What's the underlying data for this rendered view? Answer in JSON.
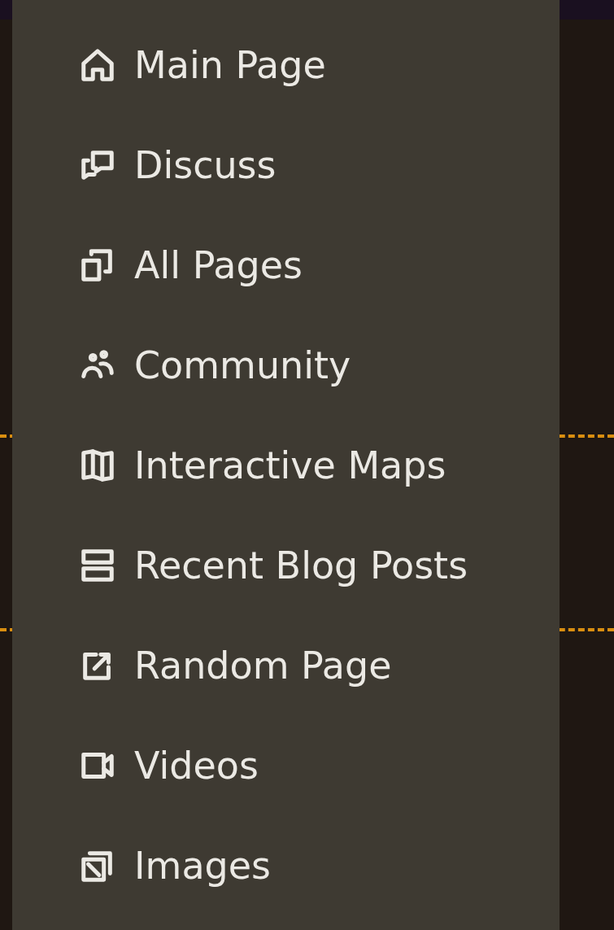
{
  "menu": {
    "items": [
      {
        "label": "Main Page"
      },
      {
        "label": "Discuss"
      },
      {
        "label": "All Pages"
      },
      {
        "label": "Community"
      },
      {
        "label": "Interactive Maps"
      },
      {
        "label": "Recent Blog Posts"
      },
      {
        "label": "Random Page"
      },
      {
        "label": "Videos"
      },
      {
        "label": "Images"
      }
    ]
  }
}
